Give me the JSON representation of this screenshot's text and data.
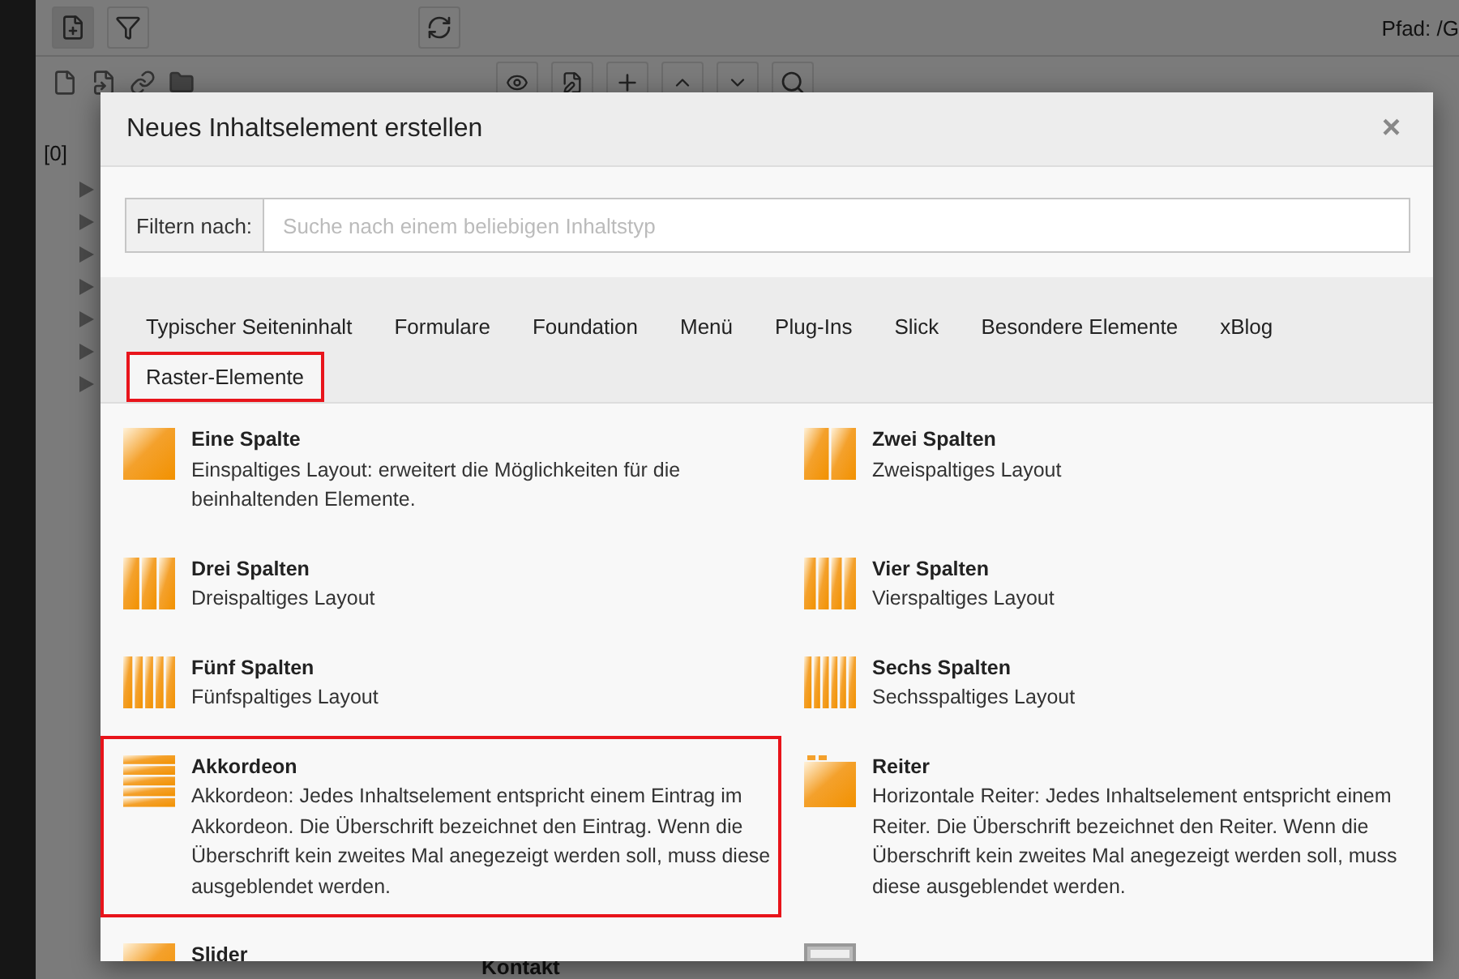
{
  "background": {
    "path_label": "Pfad: /G",
    "tree_root": "[0]",
    "content_heading": "Kontakt"
  },
  "dialog": {
    "title": "Neues Inhaltselement erstellen",
    "close": "×",
    "filter": {
      "label": "Filtern nach:",
      "placeholder": "Suche nach einem beliebigen Inhaltstyp"
    },
    "tabs": [
      {
        "label": "Typischer Seiteninhalt",
        "selected": false
      },
      {
        "label": "Formulare",
        "selected": false
      },
      {
        "label": "Foundation",
        "selected": false
      },
      {
        "label": "Menü",
        "selected": false
      },
      {
        "label": "Plug-Ins",
        "selected": false
      },
      {
        "label": "Slick",
        "selected": false
      },
      {
        "label": "Besondere Elemente",
        "selected": false
      },
      {
        "label": "xBlog",
        "selected": false
      },
      {
        "label": "Raster-Elemente",
        "selected": true
      }
    ],
    "items": [
      {
        "kind": "one-column",
        "title": "Eine Spalte",
        "description": "Einspaltiges Layout: erweitert die Möglichkeiten für die beinhaltenden Elemente.",
        "highlighted": false
      },
      {
        "kind": "two-columns",
        "title": "Zwei Spalten",
        "description": "Zweispaltiges Layout",
        "highlighted": false
      },
      {
        "kind": "three-columns",
        "title": "Drei Spalten",
        "description": "Dreispaltiges Layout",
        "highlighted": false
      },
      {
        "kind": "four-columns",
        "title": "Vier Spalten",
        "description": "Vierspaltiges Layout",
        "highlighted": false
      },
      {
        "kind": "five-columns",
        "title": "Fünf Spalten",
        "description": "Fünfspaltiges Layout",
        "highlighted": false
      },
      {
        "kind": "six-columns",
        "title": "Sechs Spalten",
        "description": "Sechsspaltiges Layout",
        "highlighted": false
      },
      {
        "kind": "accordion",
        "title": "Akkordeon",
        "description": "Akkordeon: Jedes Inhaltselement entspricht einem Eintrag im Akkordeon. Die Überschrift bezeichnet den Eintrag. Wenn die Überschrift kein zweites Mal anegezeigt werden soll, muss diese ausgeblendet werden.",
        "highlighted": true
      },
      {
        "kind": "tabs",
        "title": "Reiter",
        "description": "Horizontale Reiter: Jedes Inhaltselement entspricht einem Reiter. Die Überschrift bezeichnet den Reiter. Wenn die Überschrift kein zweites Mal anegezeigt werden soll, muss diese ausgeblendet werden.",
        "highlighted": false
      },
      {
        "kind": "slider",
        "title": "Slider",
        "highlighted": false
      },
      {
        "kind": "layout",
        "highlighted": false
      }
    ]
  }
}
